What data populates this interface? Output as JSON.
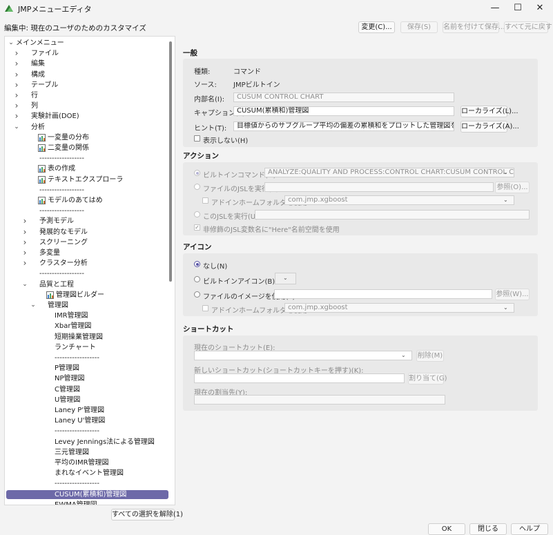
{
  "window": {
    "title": "JMPメニューエディタ"
  },
  "edit_label": "編集中: 現在のユーザのためのカスタマイズ",
  "toolbar": {
    "change": "変更(C)...",
    "save": "保存(S)",
    "save_as": "名前を付けて保存...",
    "reset_all": "すべて元に戻す"
  },
  "tree": [
    {
      "label": "メインメニュー",
      "chevron": "down",
      "indent": 0
    },
    {
      "label": "ファイル",
      "chevron": "right",
      "indent": 1
    },
    {
      "label": "編集",
      "chevron": "right",
      "indent": 1
    },
    {
      "label": "構成",
      "chevron": "right",
      "indent": 1
    },
    {
      "label": "テーブル",
      "chevron": "right",
      "indent": 1
    },
    {
      "label": "行",
      "chevron": "right",
      "indent": 1
    },
    {
      "label": "列",
      "chevron": "right",
      "indent": 1
    },
    {
      "label": "実験計画(DOE)",
      "chevron": "right",
      "indent": 1
    },
    {
      "label": "分析",
      "chevron": "down",
      "indent": 1
    },
    {
      "label": "一変量の分布",
      "icon": "distribution-icon",
      "indent": 2
    },
    {
      "label": "二変量の関係",
      "icon": "fit-y-by-x-icon",
      "indent": 2
    },
    {
      "label": "------------------",
      "indent": 2
    },
    {
      "label": "表の作成",
      "icon": "tabulate-icon",
      "indent": 2
    },
    {
      "label": "テキストエクスプローラ",
      "icon": "text-explorer-icon",
      "indent": 2
    },
    {
      "label": "------------------",
      "indent": 2
    },
    {
      "label": "モデルのあてはめ",
      "icon": "fit-model-icon",
      "indent": 2
    },
    {
      "label": "------------------",
      "indent": 2
    },
    {
      "label": "予測モデル",
      "chevron": "right",
      "indent": 2
    },
    {
      "label": "発展的なモデル",
      "chevron": "right",
      "indent": 2
    },
    {
      "label": "スクリーニング",
      "chevron": "right",
      "indent": 2
    },
    {
      "label": "多変量",
      "chevron": "right",
      "indent": 2
    },
    {
      "label": "クラスター分析",
      "chevron": "right",
      "indent": 2
    },
    {
      "label": "------------------",
      "indent": 2
    },
    {
      "label": "品質と工程",
      "chevron": "down",
      "indent": 2
    },
    {
      "label": "管理図ビルダー",
      "icon": "control-chart-builder-icon",
      "indent": 3
    },
    {
      "label": "管理図",
      "chevron": "down",
      "indent": 3
    },
    {
      "label": "IMR管理図",
      "indent": 4
    },
    {
      "label": "Xbar管理図",
      "indent": 4
    },
    {
      "label": "短期操業管理図",
      "indent": 4
    },
    {
      "label": "ランチャート",
      "indent": 4
    },
    {
      "label": "------------------",
      "indent": 4
    },
    {
      "label": "P管理図",
      "indent": 4
    },
    {
      "label": "NP管理図",
      "indent": 4
    },
    {
      "label": "C管理図",
      "indent": 4
    },
    {
      "label": "U管理図",
      "indent": 4
    },
    {
      "label": "Laney P'管理図",
      "indent": 4
    },
    {
      "label": "Laney U'管理図",
      "indent": 4
    },
    {
      "label": "------------------",
      "indent": 4
    },
    {
      "label": "Levey Jennings法による管理図",
      "indent": 4
    },
    {
      "label": "三元管理図",
      "indent": 4
    },
    {
      "label": "平均のIMR管理図",
      "indent": 4
    },
    {
      "label": "まれなイベント管理図",
      "indent": 4
    },
    {
      "label": "------------------",
      "indent": 4
    },
    {
      "label": "CUSUM(累積和)管理図",
      "indent": 4,
      "selected": true
    },
    {
      "label": "EWMA管理図",
      "indent": 4
    }
  ],
  "deselect_all": "すべての選択を解除(1)",
  "general": {
    "title": "一般",
    "type_label": "種類:",
    "type_value": "コマンド",
    "source_label": "ソース:",
    "source_value": "JMPビルトイン",
    "internal_name_label": "内部名(I):",
    "internal_name_value": "CUSUM CONTROL CHART",
    "caption_label": "キャプション(P):",
    "caption_value": "CUSUM(累積和)管理図",
    "localize_l": "ローカライズ(L)...",
    "hint_label": "ヒント(T):",
    "hint_value": "目標値からのサブグループ平均の偏差の累積和をプロットした管理図を作成する。",
    "localize_a": "ローカライズ(A)...",
    "hide_label": "表示しない(H)"
  },
  "action": {
    "title": "アクション",
    "builtin_label": "ビルトインコマンド(D):",
    "builtin_value": "ANALYZE:QUALITY AND PROCESS:CONTROL CHART:CUSUM CONTROL CHART",
    "run_file_label": "ファイルのJSLを実行(R):",
    "browse_o": "参照(O)...",
    "addin_label": "アドインホームフォルダを使用:",
    "addin_value": "com.jmp.xgboost",
    "run_jsl_label": "このJSLを実行(U):",
    "here_label": "非修飾のJSL変数名に\"Here\"名前空間を使用"
  },
  "icon": {
    "title": "アイコン",
    "none_label": "なし(N)",
    "builtin_icon_label": "ビルトインアイコン(B):",
    "file_image_label": "ファイルのイメージを使用(F):",
    "browse_w": "参照(W)...",
    "addin_label": "アドインホームフォルダを使用:",
    "addin_value": "com.jmp.xgboost"
  },
  "shortcut": {
    "title": "ショートカット",
    "current_label": "現在のショートカット(E):",
    "delete": "削除(M)",
    "new_label": "新しいショートカット(ショートカットキーを押す)(K):",
    "assign": "割り当て(G)",
    "current_assign_label": "現在の割当先(Y):"
  },
  "footer": {
    "ok": "OK",
    "close": "閉じる",
    "help": "ヘルプ"
  },
  "colors": {
    "selection": "#6d69a8",
    "radio_accent": "#5a56a6"
  }
}
